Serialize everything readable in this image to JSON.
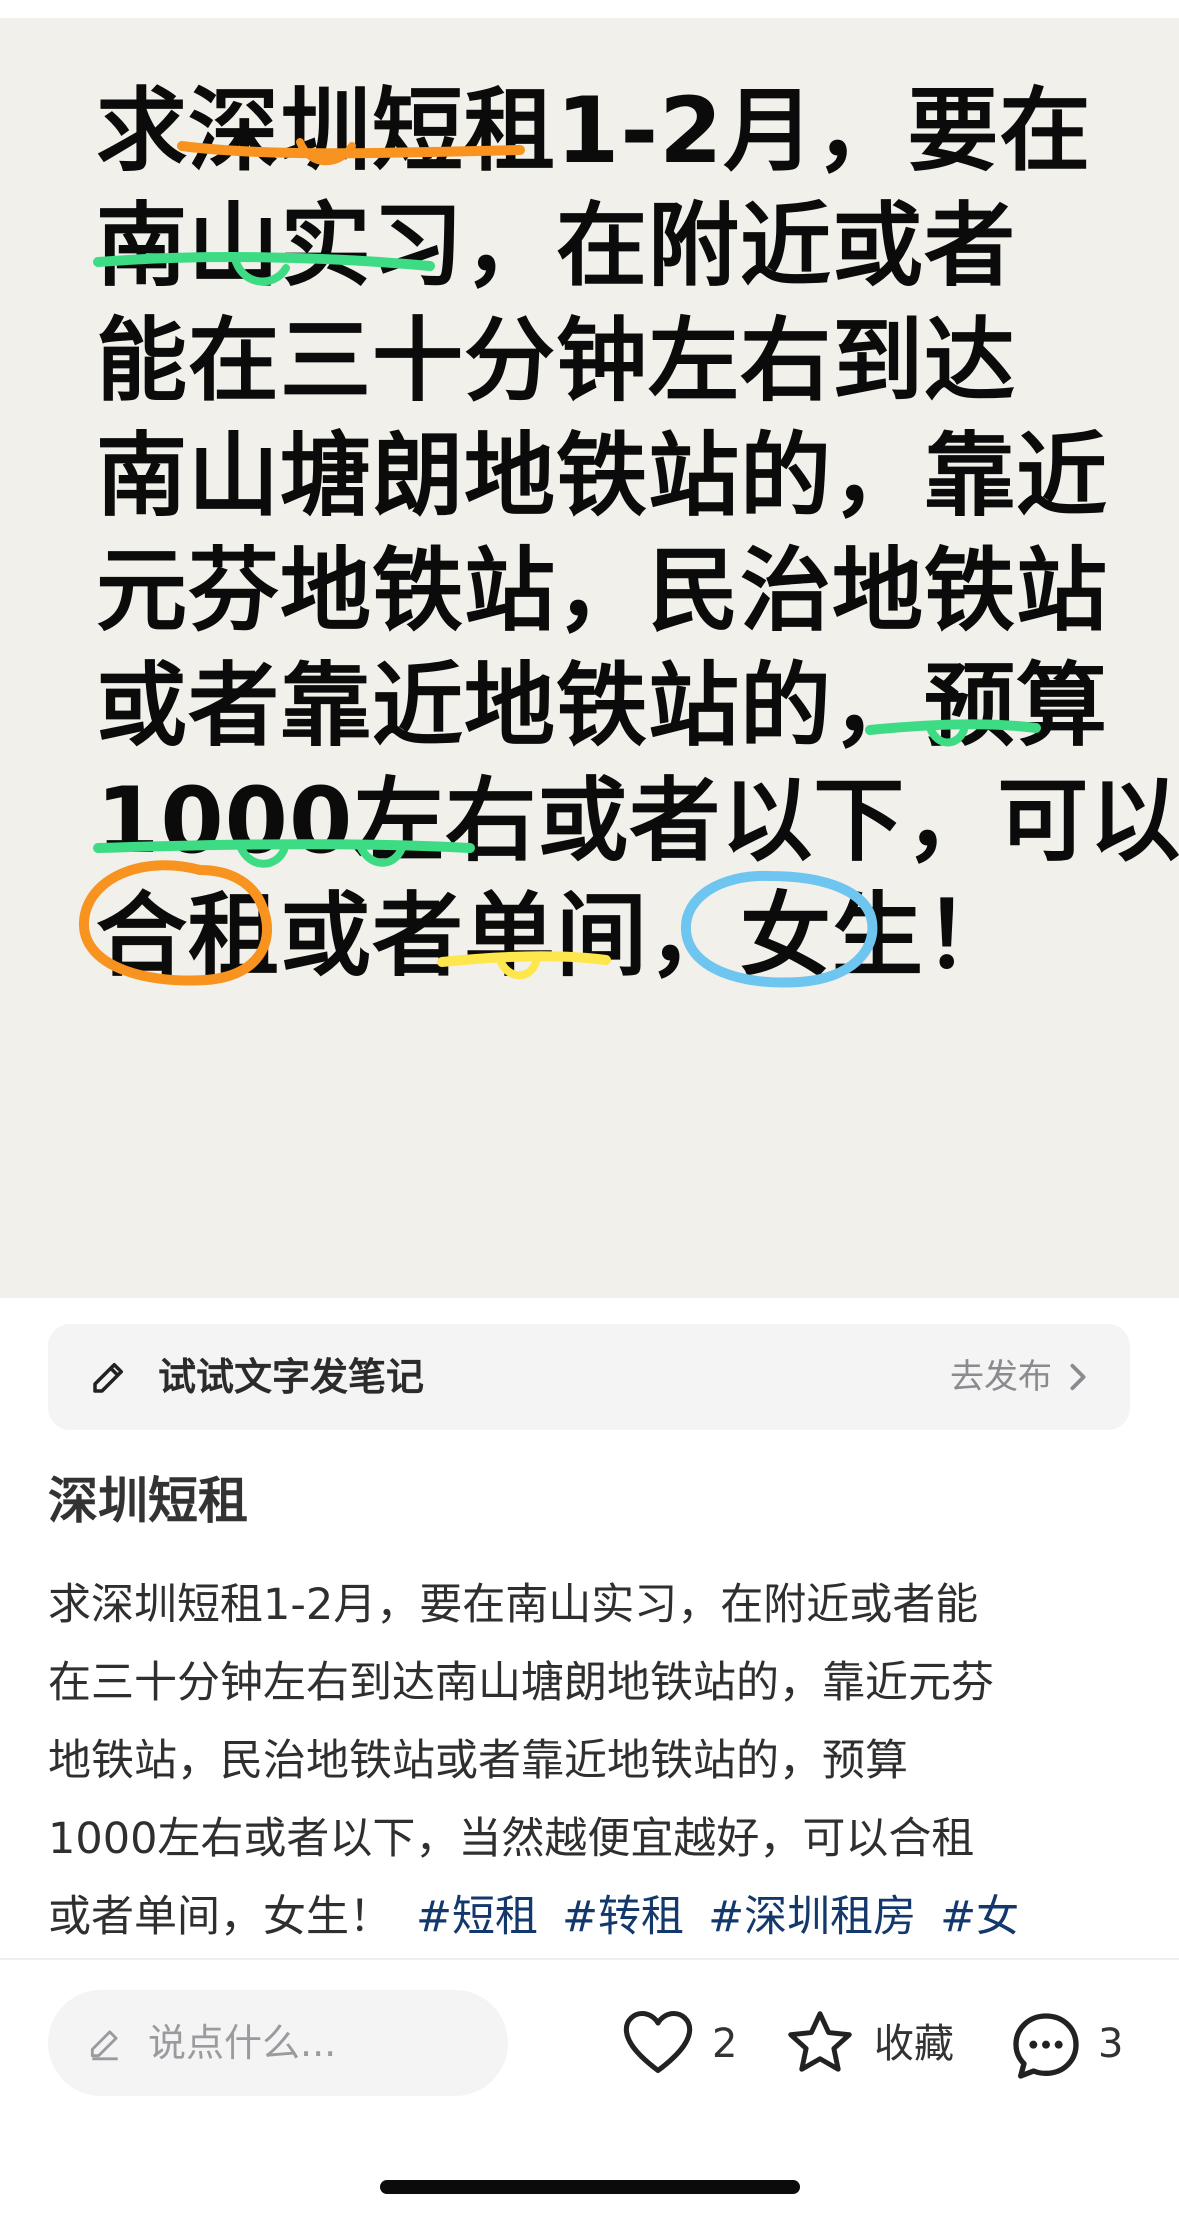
{
  "image_text_lines": [
    "求深圳短租1-2月，要在",
    "南山实习，在附近或者",
    "能在三十分钟左右到达",
    "南山塘朗地铁站的，靠近",
    "元芬地铁站，民治地铁站",
    "或者靠近地铁站的，预算",
    "1000左右或者以下，可以",
    "合租或者单间，女生！"
  ],
  "prompt_bar": {
    "icon": "pencil-icon",
    "label": "试试文字发笔记",
    "action": "去发布",
    "action_icon": "chevron-right-icon"
  },
  "note": {
    "title": "深圳短租",
    "body_lines": [
      "求深圳短租1-2月，要在南山实习，在附近或者能",
      "在三十分钟左右到达南山塘朗地铁站的，靠近元芬",
      "地铁站，民治地铁站或者靠近地铁站的，预算",
      "1000左右或者以下，当然越便宜越好，可以合租"
    ],
    "last_line": "或者单间，女生！",
    "tags": [
      "#短租",
      "#转租",
      "#深圳租房",
      "#女"
    ]
  },
  "bottom_bar": {
    "comment_placeholder": "说点什么...",
    "like_count": "2",
    "collect_label": "收藏",
    "comment_count": "3"
  },
  "colors": {
    "image_bg": "#f2f0ea",
    "mark_orange": "#f7931e",
    "mark_green": "#3ddc84",
    "mark_yellow": "#fde74c",
    "mark_blue": "#6ec6f0",
    "tag_color": "#13386c"
  }
}
